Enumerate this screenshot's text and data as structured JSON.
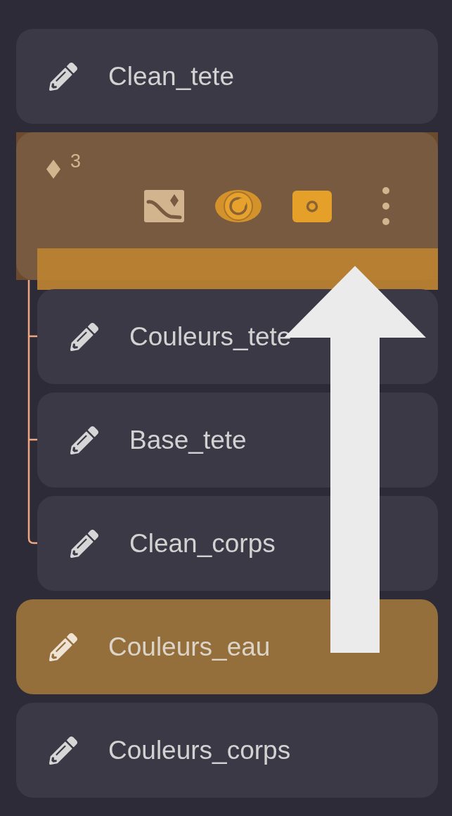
{
  "layers": [
    {
      "kind": "layer",
      "name": "Clean_tete",
      "selected": false
    },
    {
      "kind": "group",
      "count": "3",
      "expanded": true,
      "drop_target": true,
      "buttons": [
        {
          "kind": "blend",
          "on": false
        },
        {
          "kind": "visibility",
          "on": true
        },
        {
          "kind": "mask",
          "on": true
        }
      ],
      "children": [
        {
          "kind": "layer",
          "name": "Couleurs_tete",
          "selected": false
        },
        {
          "kind": "layer",
          "name": "Base_tete",
          "selected": false
        },
        {
          "kind": "layer",
          "name": "Clean_corps",
          "selected": false
        }
      ]
    },
    {
      "kind": "layer",
      "name": "Couleurs_eau",
      "selected": true
    },
    {
      "kind": "layer",
      "name": "Couleurs_corps",
      "selected": false
    }
  ]
}
